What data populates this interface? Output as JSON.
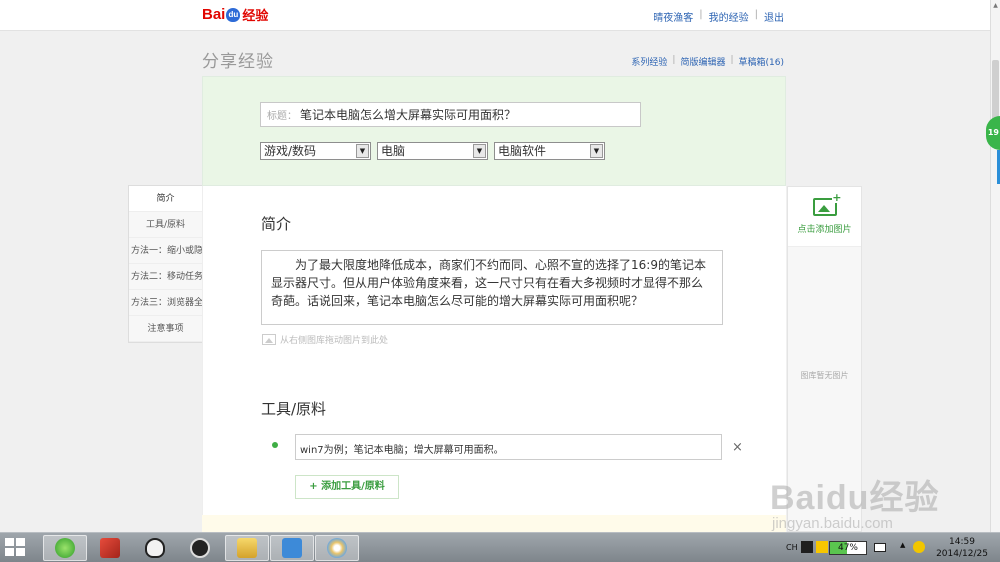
{
  "header": {
    "logo_bai": "Bai",
    "logo_du": "du",
    "logo_zh": "经验",
    "links": [
      "晴夜渔客",
      "我的经验",
      "退出"
    ]
  },
  "page": {
    "title": "分享经验",
    "sublinks": [
      "系列经验",
      "简版编辑器",
      "草稿箱(16)"
    ]
  },
  "form": {
    "title_prefix": "标题：",
    "title_value": "笔记本电脑怎么增大屏幕实际可用面积？",
    "selects": [
      "游戏/数码",
      "电脑",
      "电脑软件"
    ]
  },
  "leftnav": {
    "items": [
      "简介",
      "工具/原料",
      "方法一：缩小或隐",
      "方法二：移动任务",
      "方法三：浏览器全",
      "注意事项"
    ]
  },
  "intro": {
    "heading": "简介",
    "text": "为了最大限度地降低成本，商家们不约而同、心照不宣的选择了16:9的笔记本显示器尺寸。但从用户体验角度来看，这一尺寸只有在看大多视频时才显得不那么奇葩。话说回来，笔记本电脑怎么尽可能的增大屏幕实际可用面积呢？",
    "drag_tip": "从右侧图库拖动图片到此处"
  },
  "tools": {
    "heading": "工具/原料",
    "item_value": "win7为例；笔记本电脑；增大屏幕可用面积。",
    "remove": "×",
    "add_label": "+ 添加工具/原料"
  },
  "image_panel": {
    "add_label": "点击添加图片",
    "empty_label": "图库暂无图片"
  },
  "watermark": {
    "logo": "Baidu经验",
    "url": "jingyan.baidu.com"
  },
  "side_badge": "19",
  "taskbar": {
    "lang": "CH",
    "battery_pct": "47%",
    "battery_level": 0.47,
    "time": "14:59",
    "date": "2014/12/25"
  }
}
